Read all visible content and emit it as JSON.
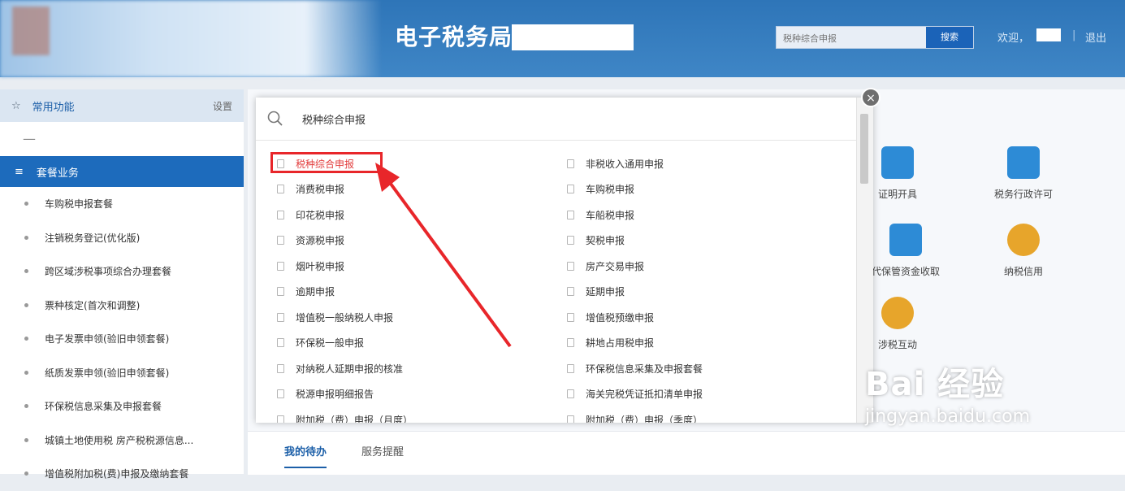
{
  "header": {
    "site_title": "电子税务局",
    "search_placeholder": "税种综合申报",
    "search_button": "搜索",
    "welcome": "欢迎，",
    "separator": "|",
    "logout": "退出"
  },
  "sidebar": {
    "favorites_label": "常用功能",
    "settings_label": "设置",
    "dash": "—",
    "package_label": "套餐业务",
    "items": [
      {
        "label": "车购税申报套餐"
      },
      {
        "label": "注销税务登记(优化版)"
      },
      {
        "label": "跨区域涉税事项综合办理套餐"
      },
      {
        "label": "票种核定(首次和调整)"
      },
      {
        "label": "电子发票申领(验旧申领套餐)"
      },
      {
        "label": "纸质发票申领(验旧申领套餐)"
      },
      {
        "label": "环保税信息采集及申报套餐"
      },
      {
        "label": "城镇土地使用税 房产税税源信息..."
      },
      {
        "label": "增值税附加税(费)申报及缴纳套餐"
      }
    ]
  },
  "main": {
    "services": [
      {
        "label": "证明开具",
        "color": "#2d8bd6"
      },
      {
        "label": "税务行政许可",
        "color": "#2d8bd6"
      },
      {
        "label": "代保管资金收取",
        "color": "#2d8bd6"
      },
      {
        "label": "纳税信用",
        "color": "#e7a52b"
      },
      {
        "label": "涉税互动",
        "color": "#e7a52b"
      }
    ],
    "tabs": [
      {
        "label": "我的待办"
      },
      {
        "label": "服务提醒"
      }
    ]
  },
  "modal": {
    "search_value": "税种综合申报",
    "left_items": [
      {
        "label": "税种综合申报"
      },
      {
        "label": "消费税申报"
      },
      {
        "label": "印花税申报"
      },
      {
        "label": "资源税申报"
      },
      {
        "label": "烟叶税申报"
      },
      {
        "label": "逾期申报"
      },
      {
        "label": "增值税一般纳税人申报"
      },
      {
        "label": "环保税一般申报"
      },
      {
        "label": "对纳税人延期申报的核准"
      },
      {
        "label": "税源申报明细报告"
      },
      {
        "label": "附加税（费）申报（月度）"
      }
    ],
    "right_items": [
      {
        "label": "非税收入通用申报"
      },
      {
        "label": "车购税申报"
      },
      {
        "label": "车船税申报"
      },
      {
        "label": "契税申报"
      },
      {
        "label": "房产交易申报"
      },
      {
        "label": "延期申报"
      },
      {
        "label": "增值税预缴申报"
      },
      {
        "label": "耕地占用税申报"
      },
      {
        "label": "环保税信息采集及申报套餐"
      },
      {
        "label": "海关完税凭证抵扣清单申报"
      },
      {
        "label": "附加税（费）申报（季度）"
      }
    ],
    "close_glyph": "×"
  },
  "watermark": {
    "brand": "Bai 经验",
    "url": "jingyan.baidu.com"
  },
  "colors": {
    "header_blue": "#2e75b8",
    "package_blue": "#1d6bbc",
    "highlight_red": "#e8262a"
  }
}
